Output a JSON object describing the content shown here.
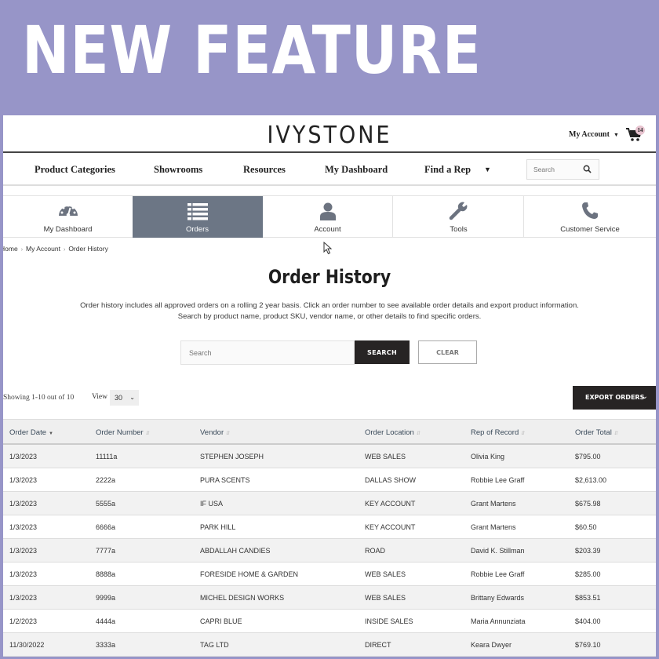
{
  "banner": {
    "title": "NEW FEATURE",
    "background": "#9795c8"
  },
  "header": {
    "logo": "IVYSTONE",
    "my_account": "My Account",
    "cart_count": "14"
  },
  "nav": {
    "items": [
      "Product Categories",
      "Showrooms",
      "Resources",
      "My Dashboard",
      "Find a Rep"
    ],
    "search_placeholder": "Search"
  },
  "tabs": [
    {
      "label": "My Dashboard",
      "icon": "dashboard-gauge-icon",
      "active": false
    },
    {
      "label": "Orders",
      "icon": "list-icon",
      "active": true
    },
    {
      "label": "Account",
      "icon": "user-icon",
      "active": false
    },
    {
      "label": "Tools",
      "icon": "wrench-icon",
      "active": false
    },
    {
      "label": "Customer Service",
      "icon": "phone-icon",
      "active": false
    }
  ],
  "breadcrumb": [
    "Home",
    "My Account",
    "Order History"
  ],
  "page": {
    "title": "Order History",
    "description_line1": "Order history includes all approved orders on a rolling 2 year basis. Click an order number to see available order details and export product information.",
    "description_line2": "Search by product name, product SKU, vendor name, or other details to find specific orders.",
    "search_placeholder": "Search",
    "search_button": "SEARCH",
    "clear_button": "CLEAR",
    "showing": "Showing 1-10 out of 10",
    "view_label": "View",
    "view_value": "30",
    "export_button": "EXPORT ORDERS"
  },
  "table": {
    "columns": [
      "Order Date",
      "Order Number",
      "Vendor",
      "Order Location",
      "Rep of Record",
      "Order Total"
    ],
    "rows": [
      [
        "1/3/2023",
        "11111a",
        "STEPHEN JOSEPH",
        "WEB SALES",
        "Olivia King",
        "$795.00"
      ],
      [
        "1/3/2023",
        "2222a",
        "PURA SCENTS",
        "DALLAS SHOW",
        "Robbie Lee Graff",
        "$2,613.00"
      ],
      [
        "1/3/2023",
        "5555a",
        "IF USA",
        "KEY ACCOUNT",
        "Grant Martens",
        "$675.98"
      ],
      [
        "1/3/2023",
        "6666a",
        "PARK HILL",
        "KEY ACCOUNT",
        "Grant Martens",
        "$60.50"
      ],
      [
        "1/3/2023",
        "7777a",
        "ABDALLAH CANDIES",
        "ROAD",
        "David K. Stillman",
        "$203.39"
      ],
      [
        "1/3/2023",
        "8888a",
        "FORESIDE HOME & GARDEN",
        "WEB SALES",
        "Robbie Lee Graff",
        "$285.00"
      ],
      [
        "1/3/2023",
        "9999a",
        "MICHEL DESIGN WORKS",
        "WEB SALES",
        "Brittany Edwards",
        "$853.51"
      ],
      [
        "1/2/2023",
        "4444a",
        "CAPRI BLUE",
        "INSIDE SALES",
        "Maria Annunziata",
        "$404.00"
      ],
      [
        "11/30/2022",
        "3333a",
        "TAG LTD",
        "DIRECT",
        "Keara Dwyer",
        "$769.10"
      ]
    ]
  }
}
